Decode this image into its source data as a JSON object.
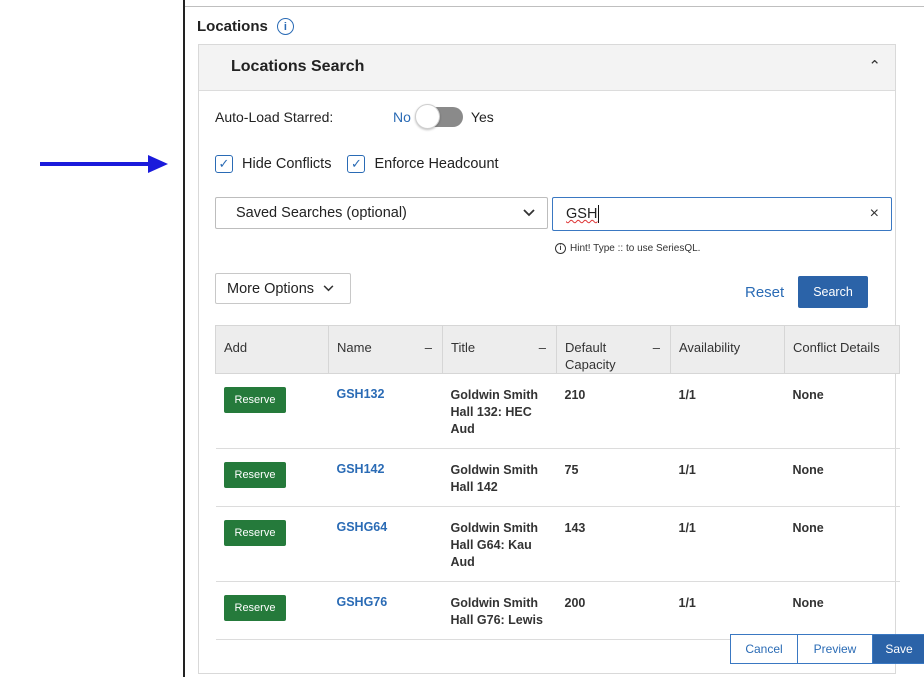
{
  "section_title": "Locations",
  "card": {
    "title": "Locations Search"
  },
  "autoload": {
    "label": "Auto-Load Starred:",
    "no": "No",
    "yes": "Yes",
    "value": "No"
  },
  "checkboxes": [
    {
      "label": "Hide Conflicts",
      "checked": true
    },
    {
      "label": "Enforce Headcount",
      "checked": true
    }
  ],
  "saved_searches": {
    "label": "Saved Searches (optional)"
  },
  "search": {
    "value": "GSH",
    "hint": "Hint! Type :: to use SeriesQL."
  },
  "more_options": "More Options",
  "reset": "Reset",
  "search_button": "Search",
  "table": {
    "headers": [
      "Add",
      "Name",
      "Title",
      "Default Capacity",
      "Availability",
      "Conflict Details"
    ],
    "rows": [
      {
        "action": "Reserve",
        "name": "GSH132",
        "title": "Goldwin Smith Hall 132: HEC Aud",
        "capacity": "210",
        "availability": "1/1",
        "conflict": "None"
      },
      {
        "action": "Reserve",
        "name": "GSH142",
        "title": "Goldwin Smith Hall 142",
        "capacity": "75",
        "availability": "1/1",
        "conflict": "None"
      },
      {
        "action": "Reserve",
        "name": "GSHG64",
        "title": "Goldwin Smith Hall G64: Kau Aud",
        "capacity": "143",
        "availability": "1/1",
        "conflict": "None"
      },
      {
        "action": "Reserve",
        "name": "GSHG76",
        "title": "Goldwin Smith Hall G76: Lewis",
        "capacity": "200",
        "availability": "1/1",
        "conflict": "None"
      }
    ]
  },
  "footer": {
    "cancel": "Cancel",
    "preview": "Preview",
    "save": "Save"
  },
  "colors": {
    "accent": "#2a6bb5",
    "reserve": "#257a3b",
    "arrow": "#1a1adb"
  }
}
